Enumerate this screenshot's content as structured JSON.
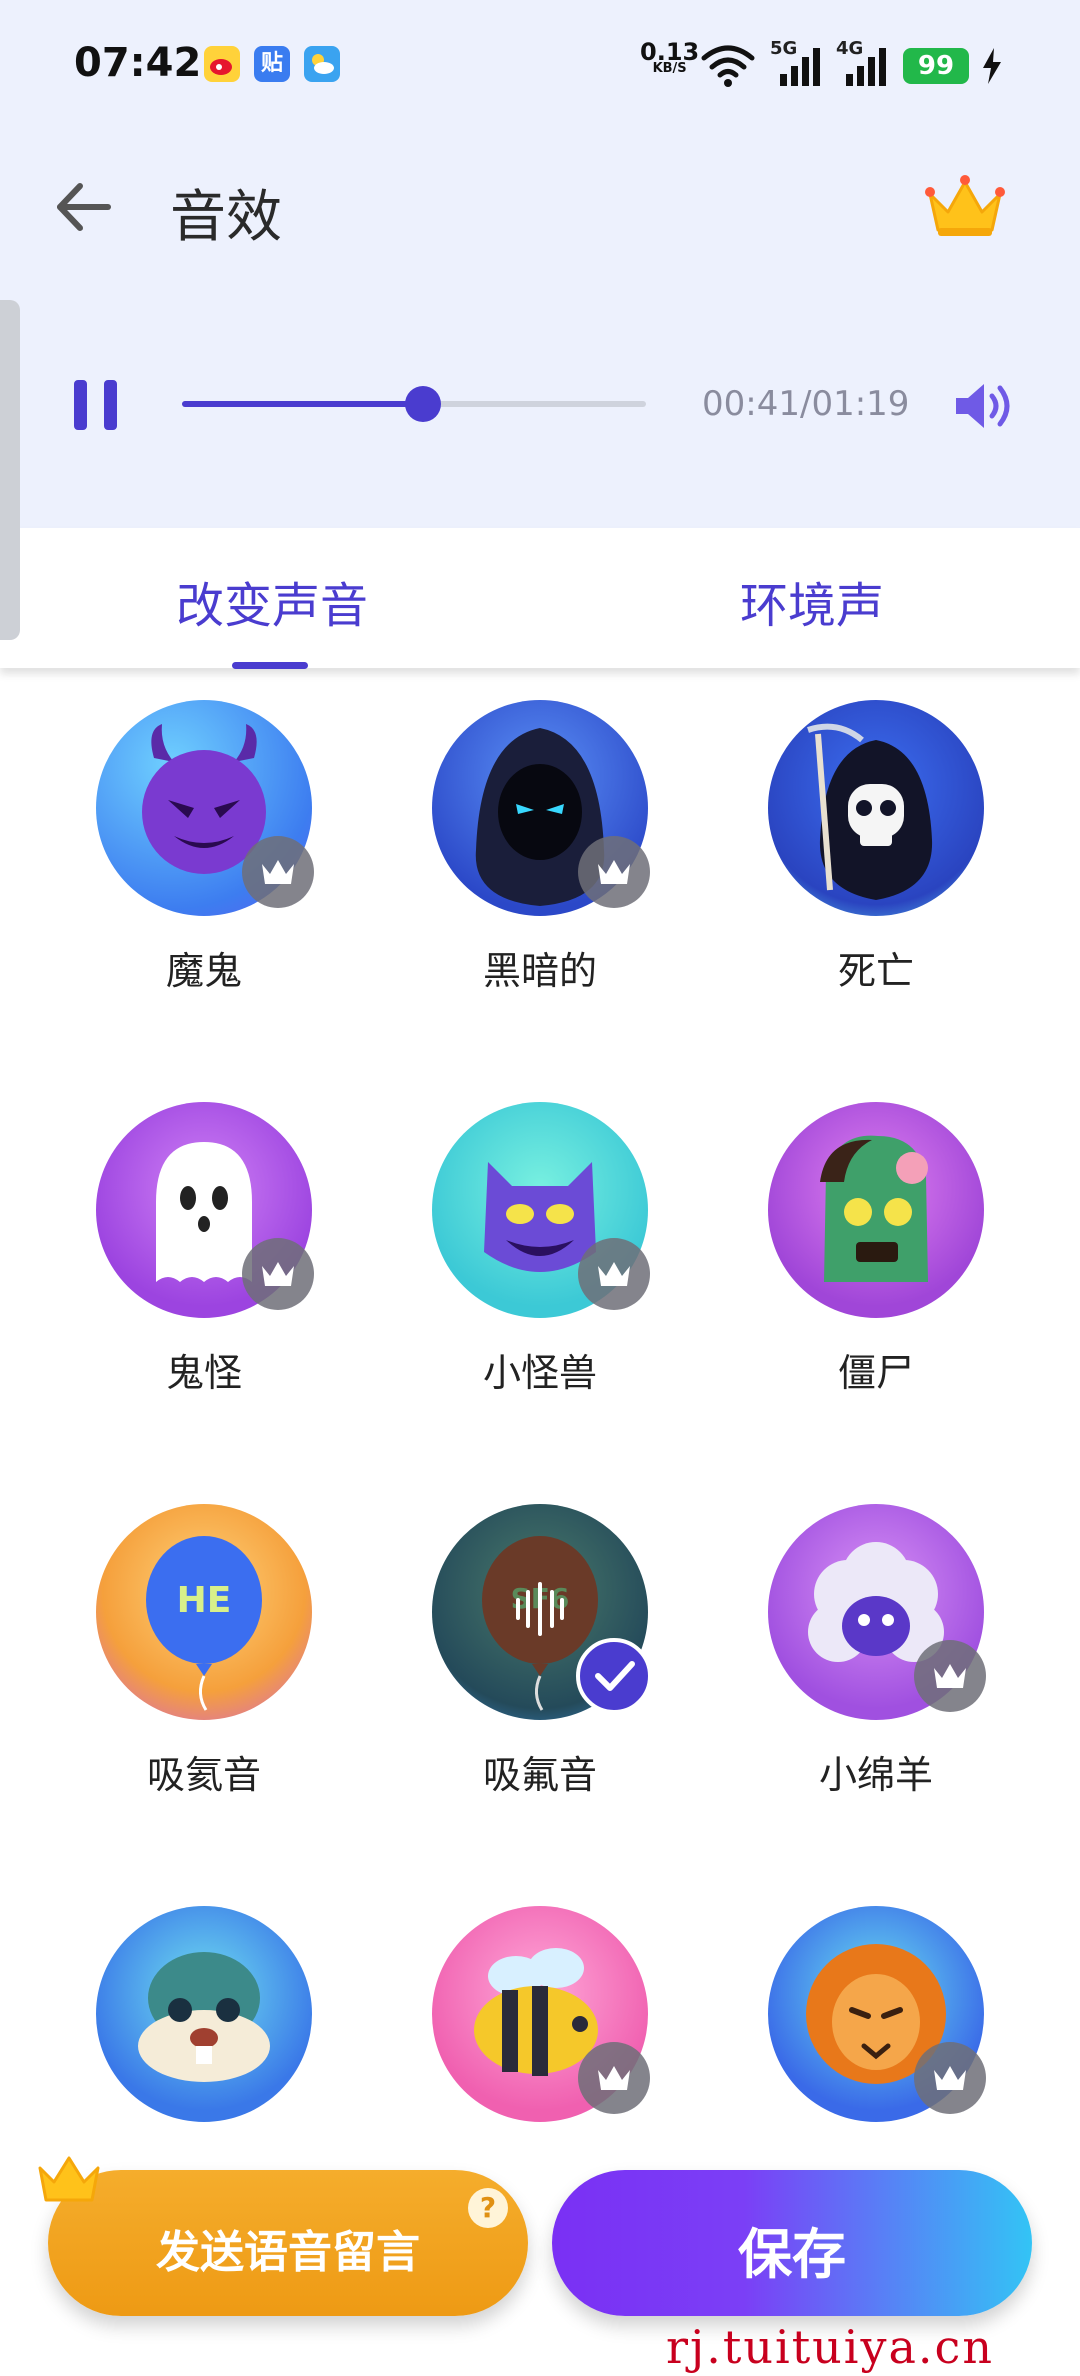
{
  "status_bar": {
    "time": "07:42",
    "net_speed": "0.13",
    "net_unit": "KB/S",
    "signal_5g": "5G",
    "signal_4g": "4G",
    "battery": "99",
    "app_icons": [
      "weibo-icon",
      "tieba-icon",
      "weather-icon"
    ],
    "tieba_label": "贴"
  },
  "header": {
    "title": "音效",
    "back_icon": "arrow-left-icon",
    "premium_icon": "crown-icon"
  },
  "player": {
    "state": "playing",
    "progress_fraction": 0.52,
    "time_text": "00:41/01:19",
    "volume_icon": "speaker-icon"
  },
  "tabs": [
    {
      "label": "改变声音",
      "active": true
    },
    {
      "label": "环境声",
      "active": false
    }
  ],
  "effects": [
    {
      "label": "魔鬼",
      "badge": "crown"
    },
    {
      "label": "黑暗的",
      "badge": "crown"
    },
    {
      "label": "死亡",
      "badge": "none"
    },
    {
      "label": "鬼怪",
      "badge": "crown"
    },
    {
      "label": "小怪兽",
      "badge": "crown"
    },
    {
      "label": "僵尸",
      "badge": "none"
    },
    {
      "label": "吸氦音",
      "badge": "none",
      "art_text": "HE"
    },
    {
      "label": "吸氟音",
      "badge": "check",
      "art_text": "SF6"
    },
    {
      "label": "小绵羊",
      "badge": "crown"
    },
    {
      "label": "",
      "badge": "none"
    },
    {
      "label": "",
      "badge": "crown"
    },
    {
      "label": "",
      "badge": "crown"
    }
  ],
  "buttons": {
    "send_voice": "发送语音留言",
    "help": "?",
    "save": "保存"
  },
  "watermark": "rj.tuituiya.cn",
  "colors": {
    "accent": "#4a3ccf",
    "header_bg": "#edf1fd",
    "send_button": "#f0a21c",
    "save_gradient_start": "#7a30f4",
    "save_gradient_end": "#33c4f5"
  }
}
